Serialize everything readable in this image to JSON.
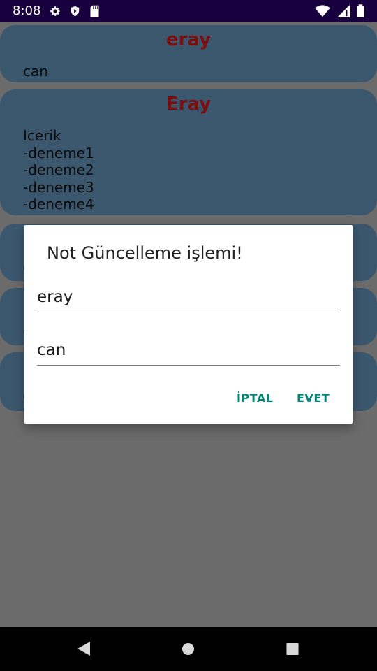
{
  "status_bar": {
    "time": "8:08",
    "left_icons": [
      "gear-icon",
      "play-shield-icon",
      "sd-card-icon"
    ],
    "right_icons": [
      "wifi-icon",
      "signal-icon",
      "battery-icon"
    ]
  },
  "notes": [
    {
      "title": "eray",
      "body": "can"
    },
    {
      "title": "Eray",
      "body": "Icerik\n-deneme1\n-deneme2\n-deneme3\n-deneme4"
    }
  ],
  "partial_notes": [
    {
      "stub": "c"
    },
    {
      "stub": "c"
    },
    {
      "stub": "c"
    }
  ],
  "dialog": {
    "title": "Not Güncelleme işlemi!",
    "title_field_value": "eray",
    "content_field_value": "can",
    "cancel_label": "İPTAL",
    "confirm_label": "EVET"
  },
  "colors": {
    "card": "#3b576e",
    "title_text": "#7d0e10",
    "button": "#00897b",
    "status_bar": "#17003d"
  }
}
